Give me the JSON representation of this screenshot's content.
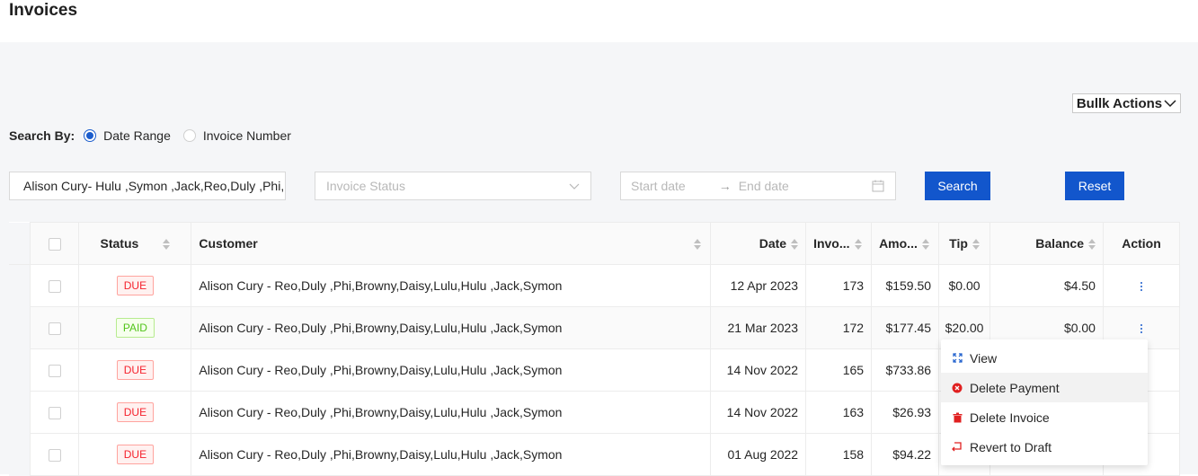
{
  "page": {
    "title": "Invoices"
  },
  "toolbar": {
    "bulk_actions_label": "Bullk Actions"
  },
  "search": {
    "label": "Search By:",
    "options": [
      {
        "label": "Date Range",
        "selected": true
      },
      {
        "label": "Invoice Number",
        "selected": false
      }
    ],
    "customer_value": "Alison Cury- Hulu ,Symon ,Jack,Reo,Duly ,Phi,Browny,Daisy,Lulu",
    "status_placeholder": "Invoice Status",
    "start_placeholder": "Start date",
    "end_placeholder": "End date",
    "search_label": "Search",
    "reset_label": "Reset"
  },
  "table": {
    "columns": [
      "Status",
      "Customer",
      "Date",
      "Invo...",
      "Amo...",
      "Tip",
      "Balance",
      "Action"
    ],
    "rows": [
      {
        "status": "DUE",
        "customer": "Alison Cury - Reo,Duly ,Phi,Browny,Daisy,Lulu,Hulu ,Jack,Symon",
        "date": "12 Apr 2023",
        "invoice": "173",
        "amount": "$159.50",
        "tip": "$0.00",
        "balance": "$4.50"
      },
      {
        "status": "PAID",
        "customer": "Alison Cury - Reo,Duly ,Phi,Browny,Daisy,Lulu,Hulu ,Jack,Symon",
        "date": "21 Mar 2023",
        "invoice": "172",
        "amount": "$177.45",
        "tip": "$20.00",
        "balance": "$0.00"
      },
      {
        "status": "DUE",
        "customer": "Alison Cury - Reo,Duly ,Phi,Browny,Daisy,Lulu,Hulu ,Jack,Symon",
        "date": "14 Nov 2022",
        "invoice": "165",
        "amount": "$733.86",
        "tip": "",
        "balance": ""
      },
      {
        "status": "DUE",
        "customer": "Alison Cury - Reo,Duly ,Phi,Browny,Daisy,Lulu,Hulu ,Jack,Symon",
        "date": "14 Nov 2022",
        "invoice": "163",
        "amount": "$26.93",
        "tip": "",
        "balance": ""
      },
      {
        "status": "DUE",
        "customer": "Alison Cury - Reo,Duly ,Phi,Browny,Daisy,Lulu,Hulu ,Jack,Symon",
        "date": "01 Aug 2022",
        "invoice": "158",
        "amount": "$94.22",
        "tip": "",
        "balance": ""
      }
    ]
  },
  "action_menu": {
    "items": [
      {
        "label": "View",
        "icon": "expand-icon"
      },
      {
        "label": "Delete Payment",
        "icon": "close-circle-icon"
      },
      {
        "label": "Delete Invoice",
        "icon": "trash-icon"
      },
      {
        "label": "Revert to Draft",
        "icon": "revert-icon"
      }
    ]
  },
  "colors": {
    "primary": "#1256cc",
    "due": "#f5222d",
    "paid": "#52c41a",
    "panel": "#f5f6f8"
  }
}
